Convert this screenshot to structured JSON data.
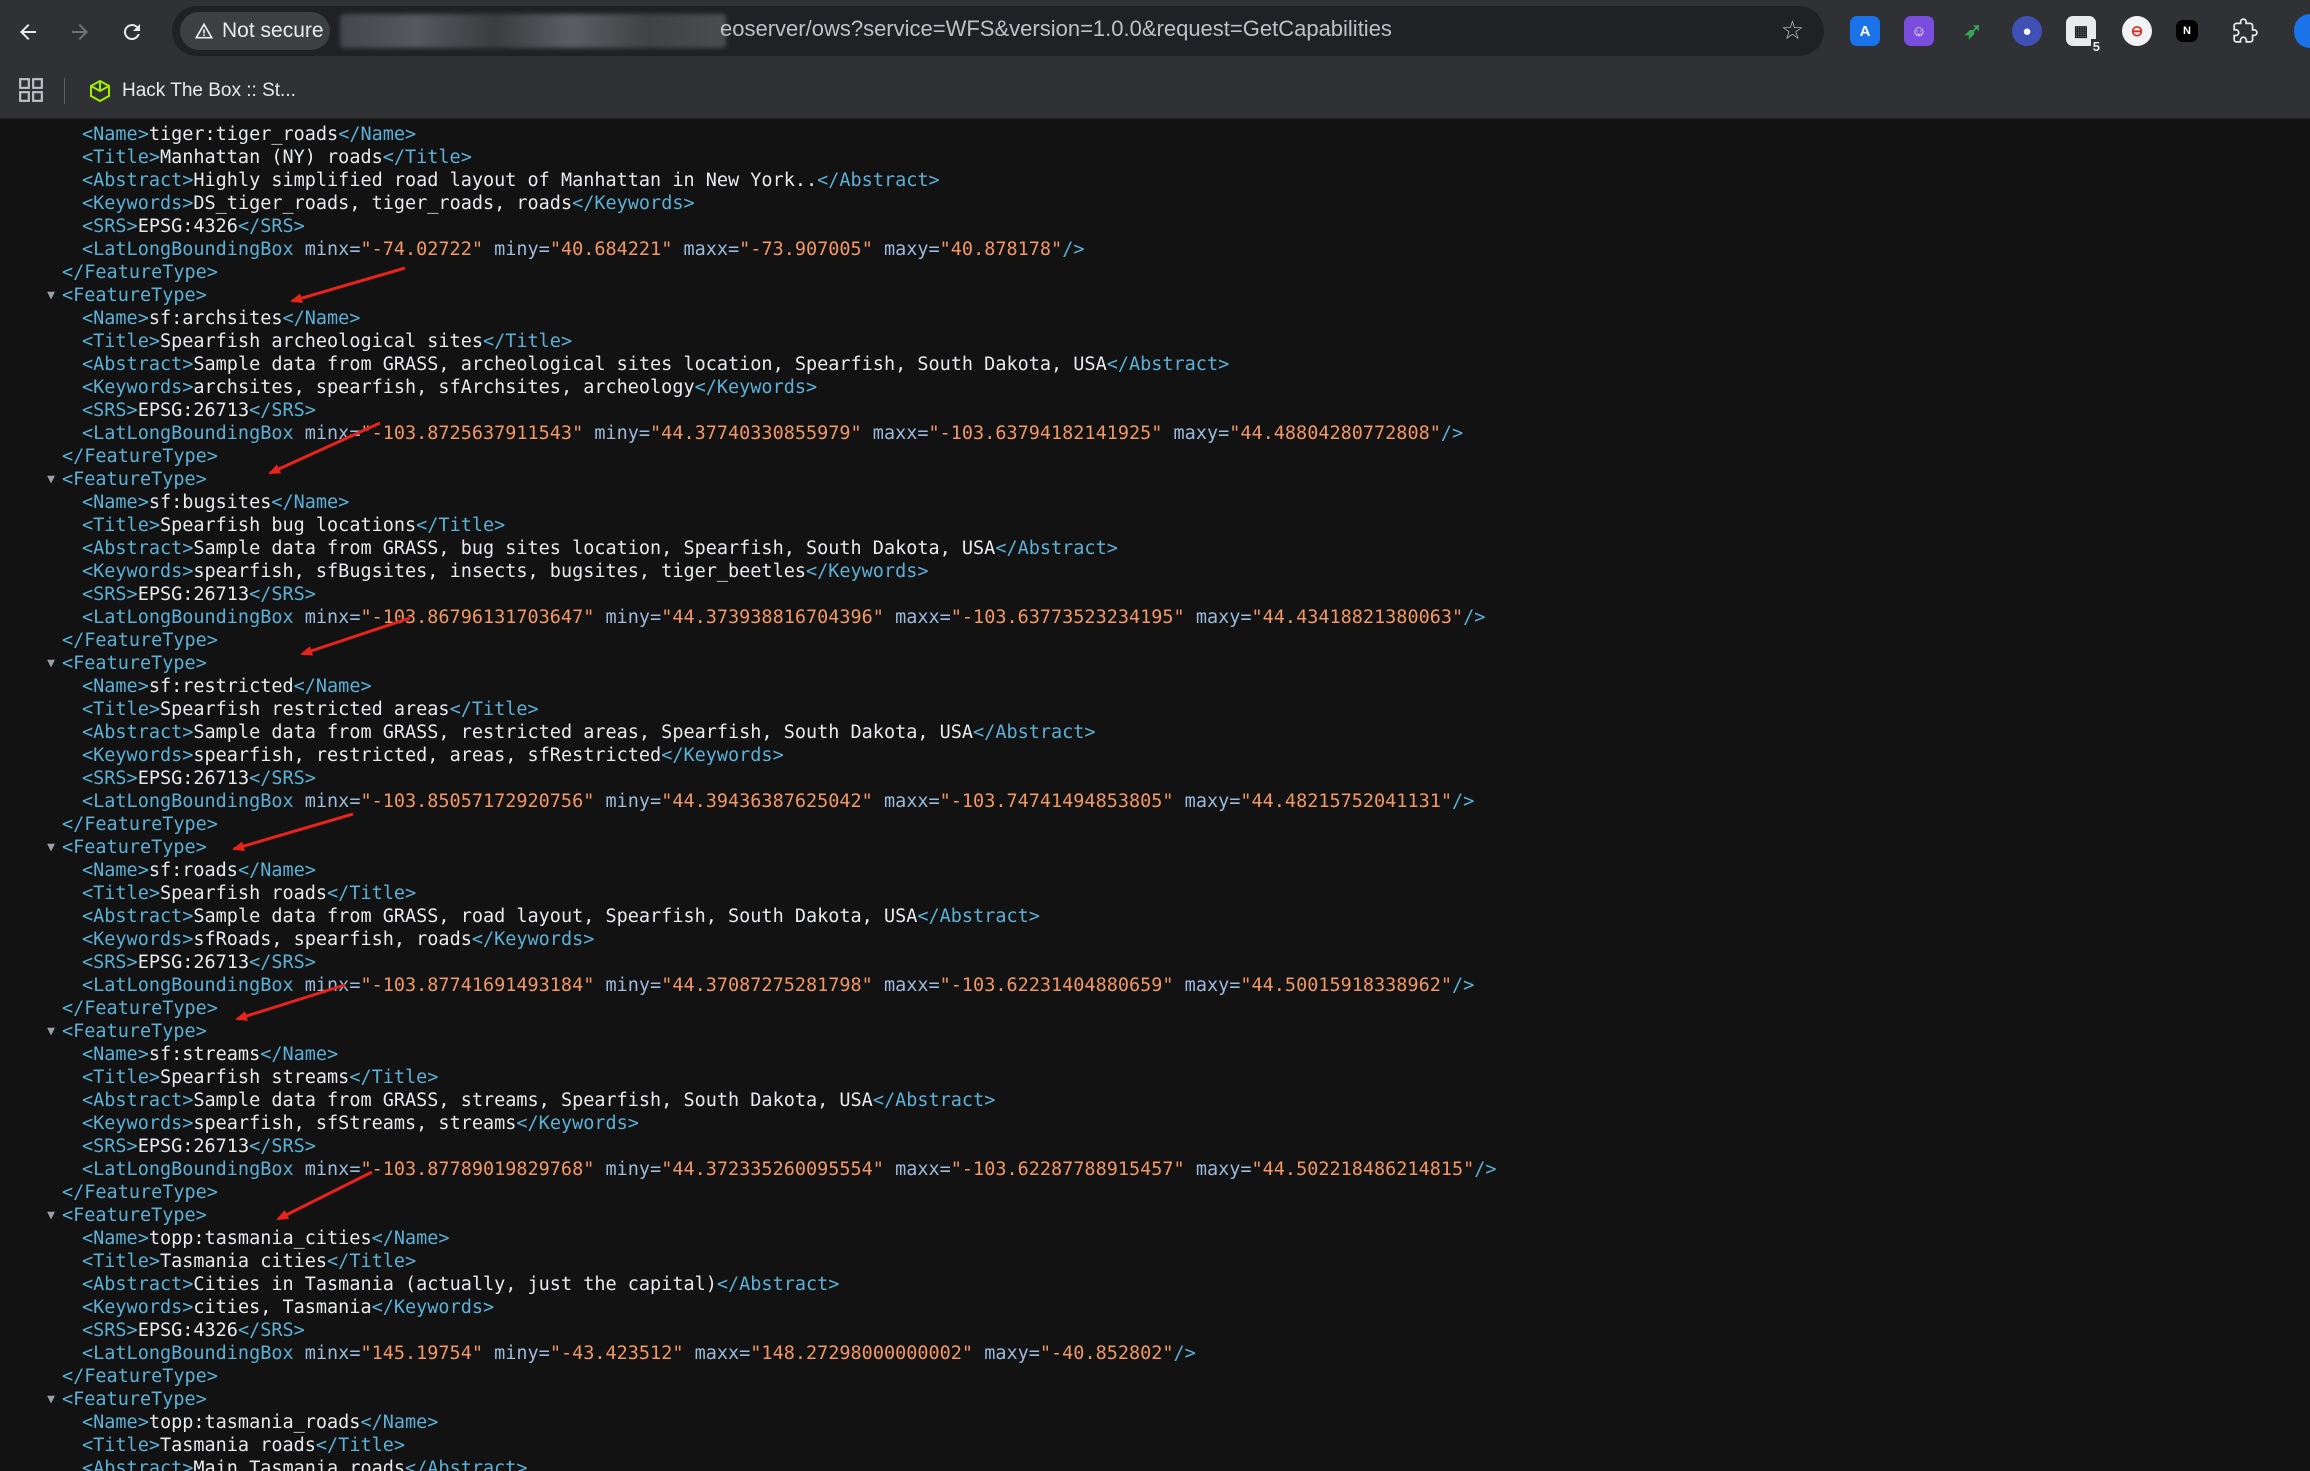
{
  "browser": {
    "security_label": "Not secure",
    "url_visible": "eoserver/ows?service=WFS&version=1.0.0&request=GetCapabilities",
    "bookmark_label": "Hack The Box :: St...",
    "extension_badge": "5",
    "icons": [
      "back-arrow-icon",
      "forward-arrow-icon",
      "reload-icon",
      "warning-triangle-icon",
      "star-icon",
      "extensions-puzzle-icon",
      "apps-grid-icon",
      "hackthebox-cube-icon"
    ]
  },
  "xml": {
    "tags": {
      "name_open": "<Name>",
      "name_close": "</Name>",
      "title_open": "<Title>",
      "title_close": "</Title>",
      "abstract_open": "<Abstract>",
      "abstract_close": "</Abstract>",
      "keywords_open": "<Keywords>",
      "keywords_close": "</Keywords>",
      "srs_open": "<SRS>",
      "srs_close": "</SRS>",
      "bbox_open": "<LatLongBoundingBox",
      "bbox_close": "/>",
      "ft_open": "<FeatureType>",
      "ft_close": "</FeatureType>",
      "minx": " minx=",
      "miny": " miny=",
      "maxx": " maxx=",
      "maxy": " maxy="
    },
    "partial": {
      "name": "tiger:tiger_roads",
      "title": "Manhattan (NY) roads",
      "abstract": "Highly simplified road layout of Manhattan in New York..",
      "keywords": "DS_tiger_roads, tiger_roads, roads",
      "srs": "EPSG:4326",
      "bbox": {
        "minx": "\"-74.02722\"",
        "miny": "\"40.684221\"",
        "maxx": "\"-73.907005\"",
        "maxy": "\"40.878178\""
      }
    },
    "feature_types": [
      {
        "name": "sf:archsites",
        "title": "Spearfish archeological sites",
        "abstract": "Sample data from GRASS, archeological sites location, Spearfish, South Dakota, USA",
        "keywords": "archsites, spearfish, sfArchsites, archeology",
        "srs": "EPSG:26713",
        "bbox": {
          "minx": "\"-103.8725637911543\"",
          "miny": "\"44.37740330855979\"",
          "maxx": "\"-103.63794182141925\"",
          "maxy": "\"44.48804280772808\""
        }
      },
      {
        "name": "sf:bugsites",
        "title": "Spearfish bug locations",
        "abstract": "Sample data from GRASS, bug sites location, Spearfish, South Dakota, USA",
        "keywords": "spearfish, sfBugsites, insects, bugsites, tiger_beetles",
        "srs": "EPSG:26713",
        "bbox": {
          "minx": "\"-103.86796131703647\"",
          "miny": "\"44.373938816704396\"",
          "maxx": "\"-103.63773523234195\"",
          "maxy": "\"44.43418821380063\""
        }
      },
      {
        "name": "sf:restricted",
        "title": "Spearfish restricted areas",
        "abstract": "Sample data from GRASS, restricted areas, Spearfish, South Dakota, USA",
        "keywords": "spearfish, restricted, areas, sfRestricted",
        "srs": "EPSG:26713",
        "bbox": {
          "minx": "\"-103.85057172920756\"",
          "miny": "\"44.39436387625042\"",
          "maxx": "\"-103.74741494853805\"",
          "maxy": "\"44.48215752041131\""
        }
      },
      {
        "name": "sf:roads",
        "title": "Spearfish roads",
        "abstract": "Sample data from GRASS, road layout, Spearfish, South Dakota, USA",
        "keywords": "sfRoads, spearfish, roads",
        "srs": "EPSG:26713",
        "bbox": {
          "minx": "\"-103.87741691493184\"",
          "miny": "\"44.37087275281798\"",
          "maxx": "\"-103.62231404880659\"",
          "maxy": "\"44.50015918338962\""
        }
      },
      {
        "name": "sf:streams",
        "title": "Spearfish streams",
        "abstract": "Sample data from GRASS, streams, Spearfish, South Dakota, USA",
        "keywords": "spearfish, sfStreams, streams",
        "srs": "EPSG:26713",
        "bbox": {
          "minx": "\"-103.87789019829768\"",
          "miny": "\"44.372335260095554\"",
          "maxx": "\"-103.62287788915457\"",
          "maxy": "\"44.502218486214815\""
        }
      },
      {
        "name": "topp:tasmania_cities",
        "title": "Tasmania cities",
        "abstract": "Cities in Tasmania (actually, just the capital)",
        "keywords": "cities, Tasmania",
        "srs": "EPSG:4326",
        "bbox": {
          "minx": "\"145.19754\"",
          "miny": "\"-43.423512\"",
          "maxx": "\"148.27298000000002\"",
          "maxy": "\"-40.852802\""
        }
      }
    ],
    "last": {
      "name": "topp:tasmania_roads",
      "title": "Tasmania roads",
      "abstract": "Main Tasmania roads"
    }
  }
}
